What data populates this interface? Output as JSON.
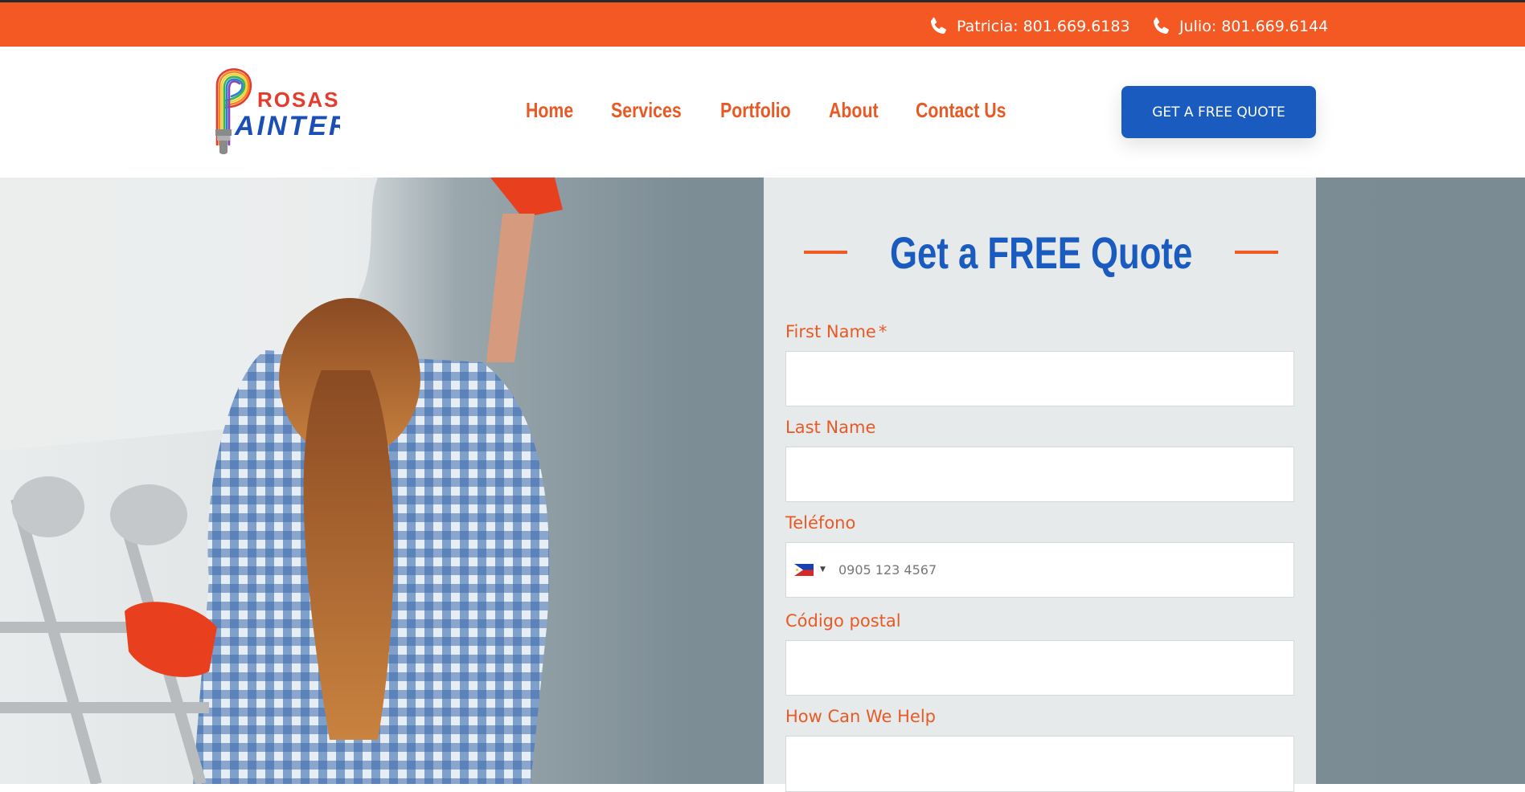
{
  "topbar": {
    "phones": [
      {
        "icon": "phone-icon",
        "label": "Patricia: 801.669.6183"
      },
      {
        "icon": "phone-icon",
        "label": "Julio: 801.669.6144"
      }
    ]
  },
  "header": {
    "logo": {
      "line1": "ROSAS",
      "line2": "AINTER",
      "initial": "P"
    },
    "nav": [
      "Home",
      "Services",
      "Portfolio",
      "About",
      "Contact Us"
    ],
    "cta": "GET A FREE QUOTE"
  },
  "form": {
    "title": "Get a FREE Quote",
    "first_name": {
      "label": "First Name",
      "required": "*",
      "value": ""
    },
    "last_name": {
      "label": "Last Name",
      "value": ""
    },
    "phone": {
      "label": "Teléfono",
      "placeholder": "0905 123 4567",
      "country": "PH"
    },
    "postal": {
      "label": "Código postal",
      "value": ""
    },
    "help": {
      "label": "How Can We Help",
      "value": ""
    }
  },
  "colors": {
    "orange": "#f45823",
    "blue": "#1a5bbf",
    "panel": "#e6eaeb"
  }
}
